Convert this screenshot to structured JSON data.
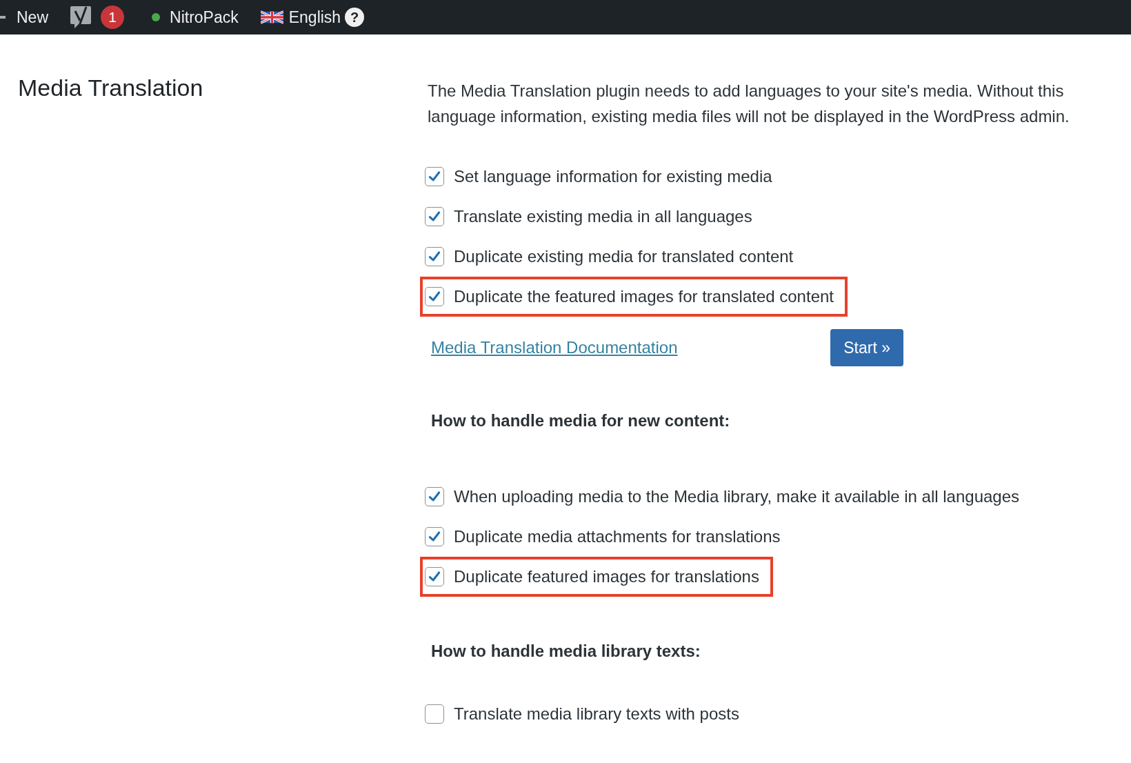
{
  "admin_bar": {
    "new_label": "New",
    "notification_count": "1",
    "plugin_label": "NitroPack",
    "language_label": "English",
    "help_label": "?"
  },
  "page_title": "Media Translation",
  "description": "The Media Translation plugin needs to add languages to your site's media. Without this language information, existing media files will not be displayed in the WordPress admin.",
  "sections": [
    {
      "options": [
        {
          "label": "Set language information for existing media",
          "checked": true,
          "highlighted": false
        },
        {
          "label": "Translate existing media in all languages",
          "checked": true,
          "highlighted": false
        },
        {
          "label": "Duplicate existing media for translated content",
          "checked": true,
          "highlighted": false
        },
        {
          "label": "Duplicate the featured images for translated content",
          "checked": true,
          "highlighted": true
        }
      ],
      "link": "Media Translation Documentation",
      "button": "Start »"
    },
    {
      "heading": "How to handle media for new content:",
      "options": [
        {
          "label": "When uploading media to the Media library, make it available in all languages",
          "checked": true,
          "highlighted": false
        },
        {
          "label": "Duplicate media attachments for translations",
          "checked": true,
          "highlighted": false
        },
        {
          "label": "Duplicate featured images for translations",
          "checked": true,
          "highlighted": true
        }
      ]
    },
    {
      "heading": "How to handle media library texts:",
      "options": [
        {
          "label": "Translate media library texts with posts",
          "checked": false,
          "highlighted": false
        }
      ]
    }
  ]
}
